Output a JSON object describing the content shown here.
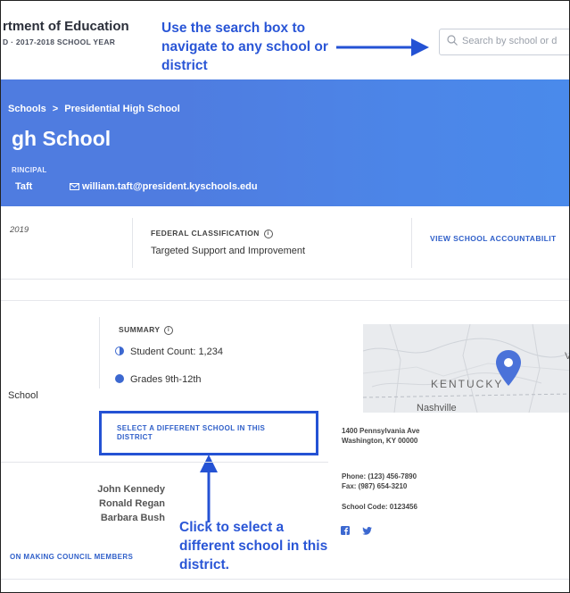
{
  "header": {
    "dept_name": "rtment of Education",
    "dept_sub": "D · 2017-2018 SCHOOL YEAR",
    "search_placeholder": "Search by school or d",
    "callout_search": "Use the search box to navigate to any school or district"
  },
  "banner": {
    "breadcrumb_parent": "Schools",
    "breadcrumb_sep": ">",
    "breadcrumb_current": "Presidential High School",
    "school_title": "gh School",
    "principal_label": "RINCIPAL",
    "principal_name": "Taft",
    "principal_email": "william.taft@president.kyschools.edu"
  },
  "info_strip": {
    "year": "2019",
    "federal_label": "FEDERAL CLASSIFICATION",
    "federal_value": "Targeted Support and Improvement",
    "view_accountability": "VIEW SCHOOL ACCOUNTABILIT"
  },
  "summary": {
    "label": "SUMMARY",
    "student_count": "Student Count: 1,234",
    "grades": "Grades 9th-12th",
    "school_fragment": "School",
    "select_different": "SELECT A DIFFERENT SCHOOL IN THIS DISTRICT"
  },
  "council": {
    "members": [
      "John Kennedy",
      "Ronald Regan",
      "Barbara Bush"
    ],
    "link": "ON MAKING COUNCIL MEMBERS"
  },
  "callout_select": "Click to select a different school in this district.",
  "map": {
    "state_label": "KENTUCKY",
    "city_label": "Nashville",
    "edge_label": "V"
  },
  "contact": {
    "address_line1": "1400 Pennsylvania Ave",
    "address_line2": "Washington, KY 00000",
    "phone": "Phone: (123) 456-7890",
    "fax": "Fax: (987) 654-3210",
    "school_code": "School Code: 0123456"
  },
  "colors": {
    "banner": "#4f7ce0",
    "link": "#2f5fc9",
    "annotation": "#2452d4"
  },
  "icons": [
    "search-icon",
    "mail-icon",
    "info-icon",
    "half-circle-icon",
    "grade-icon",
    "map-pin-icon",
    "facebook-icon",
    "twitter-icon"
  ]
}
